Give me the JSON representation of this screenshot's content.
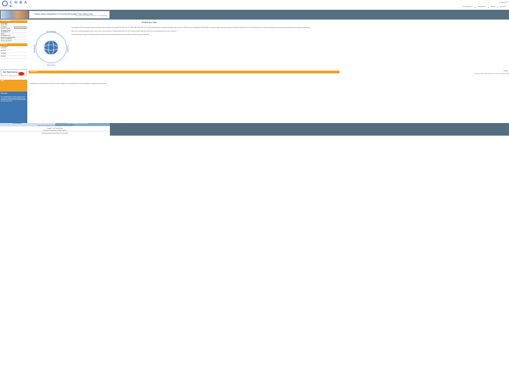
{
  "header": {
    "logo_text": "C O R A L",
    "logo_tagline": "coral consulting group",
    "date": "26 June 2011",
    "nav": [
      "Consulting Services",
      "Training Services",
      "Partners",
      "Contact Us"
    ]
  },
  "banner": {
    "headline": "\"I visited various cryptography in IT more than 90 seconds?\" save joining course",
    "subline": "join us now for our recent seminar on the topics of IT security & QA today"
  },
  "sidebar": {
    "section1_title": "CORAL Services",
    "items1": [
      "HOME PAGE",
      "Pay per Click",
      "Consultants",
      "Executive Training",
      "Technology Training",
      "Quality Assurance",
      "QA & IT",
      "Security Awareness",
      "Best Practice Implementation",
      "Services and Solutions",
      "Courses and Training"
    ],
    "section2_title": "Resources",
    "items2": [
      "IT Professional Certification",
      "ISO 27001",
      "ISO 20000",
      "ISO 9000"
    ],
    "ftc_text": "Fast Track Courses",
    "news_title": "News",
    "info_title": "Information",
    "info_text": "Coral Consulting Group is a leading company specialised in providing IT consulting, training and managed services to organisations of all sizes. We have trained and certified thousands of professionals."
  },
  "main": {
    "page_title": "Coral Focus Area",
    "focus_logo_words": [
      "Consulting",
      "Training",
      "Services",
      "Solutions"
    ],
    "intro": [
      "Coral dedicated to deliver the management objective with specific focus on Information Security (ISO 27001, ISO 27002, PCI, COBIT, CISSP, CISM, CISA, ITIL, ISO 20000, BS 25999) Business Continuity & Disaster Recovery, IT governance (COBIT) and IT Service Management (ITIL/ISO 20000). Our expertise is based on decades of experience in delivering commercially successful consulting programmes. Our approach to building these teams has been spearheaded by many of our experienced professionals.",
      "With a track record of strong experience in all core sectors such as Telecom, Banking, IT, Hospitality, Manufacturing, Oil & Gas, Government, Health, Education, and more, we are well positioned to meet our clients' requirements.",
      "Our methods in project management methodology and training combine with our own tools and frameworks to build a standard of excellence in every project we deliver."
    ],
    "subbar_title": "Latest News",
    "subbar_right": "View All",
    "sublinks": "Current Issue | Events | Upcoming Courses | Contact | Newsletter | Sitemap",
    "body_text": "Coral dedicated to providing world-class training – we would be happy to hear of any questions you may have regarding our consulting and training services."
  },
  "footer": {
    "left_title": "Join our Mailing List",
    "right_title": "Home | Consulting | Training | Contact",
    "lines": [
      "Security & Quality Training | ISO 27001 | ISO 20000 | ITIL | COBIT | CISSP | CISA",
      "Copyright © Coral Consulting Group",
      "Terms of Use | Privacy Policy | Site Map | Contact Us",
      "Website designed and maintained by Coral Consulting Group"
    ]
  },
  "colors": {
    "accent_orange": "#f5a020",
    "bar_slate": "#566f80",
    "sidebar_blue": "#3e78b5",
    "title_blue": "#24487e"
  }
}
